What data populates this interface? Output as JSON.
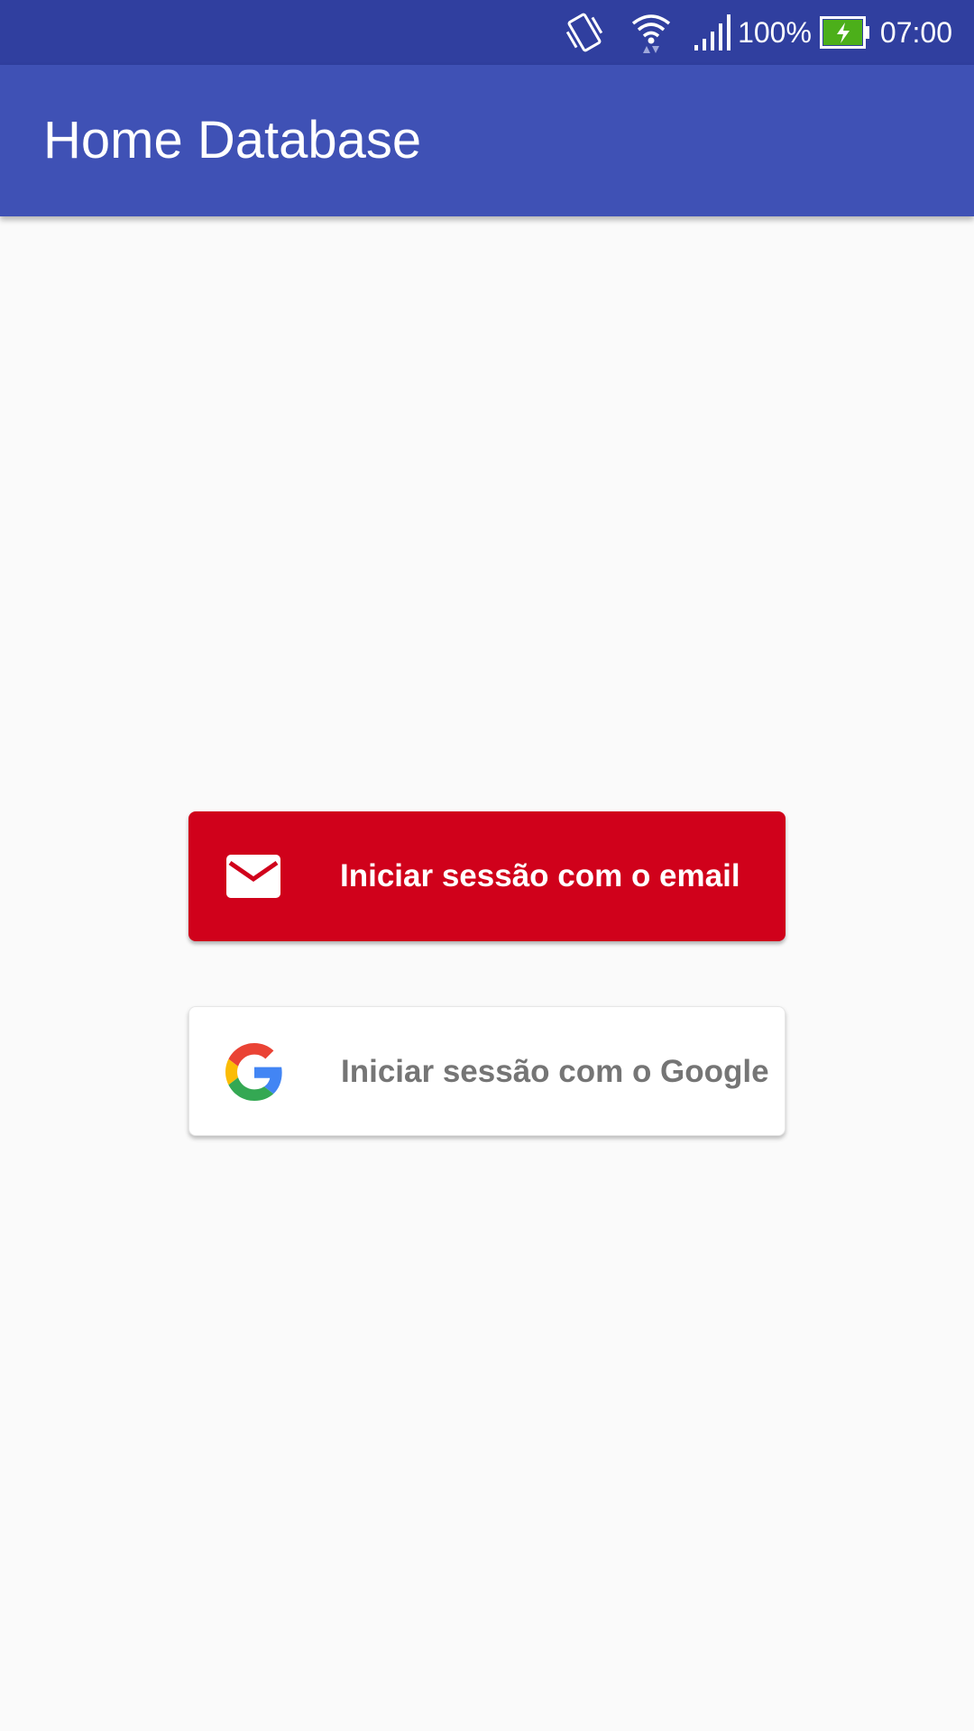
{
  "status_bar": {
    "battery_percent": "100%",
    "time": "07:00",
    "icons": [
      "vibrate-icon",
      "wifi-icon",
      "signal-icon",
      "battery-charging-icon"
    ],
    "battery_level": 1.0,
    "battery_fill_color": "#4caf1a"
  },
  "app_bar": {
    "title": "Home Database",
    "color": "#3f51b5",
    "status_color": "#303f9f"
  },
  "sign_in": {
    "email_button": {
      "label": "Iniciar sessão com o email",
      "icon": "mail-icon",
      "color": "#d0011b"
    },
    "google_button": {
      "label": "Iniciar sessão com o Google",
      "icon": "google-logo-icon",
      "color": "#ffffff"
    }
  }
}
